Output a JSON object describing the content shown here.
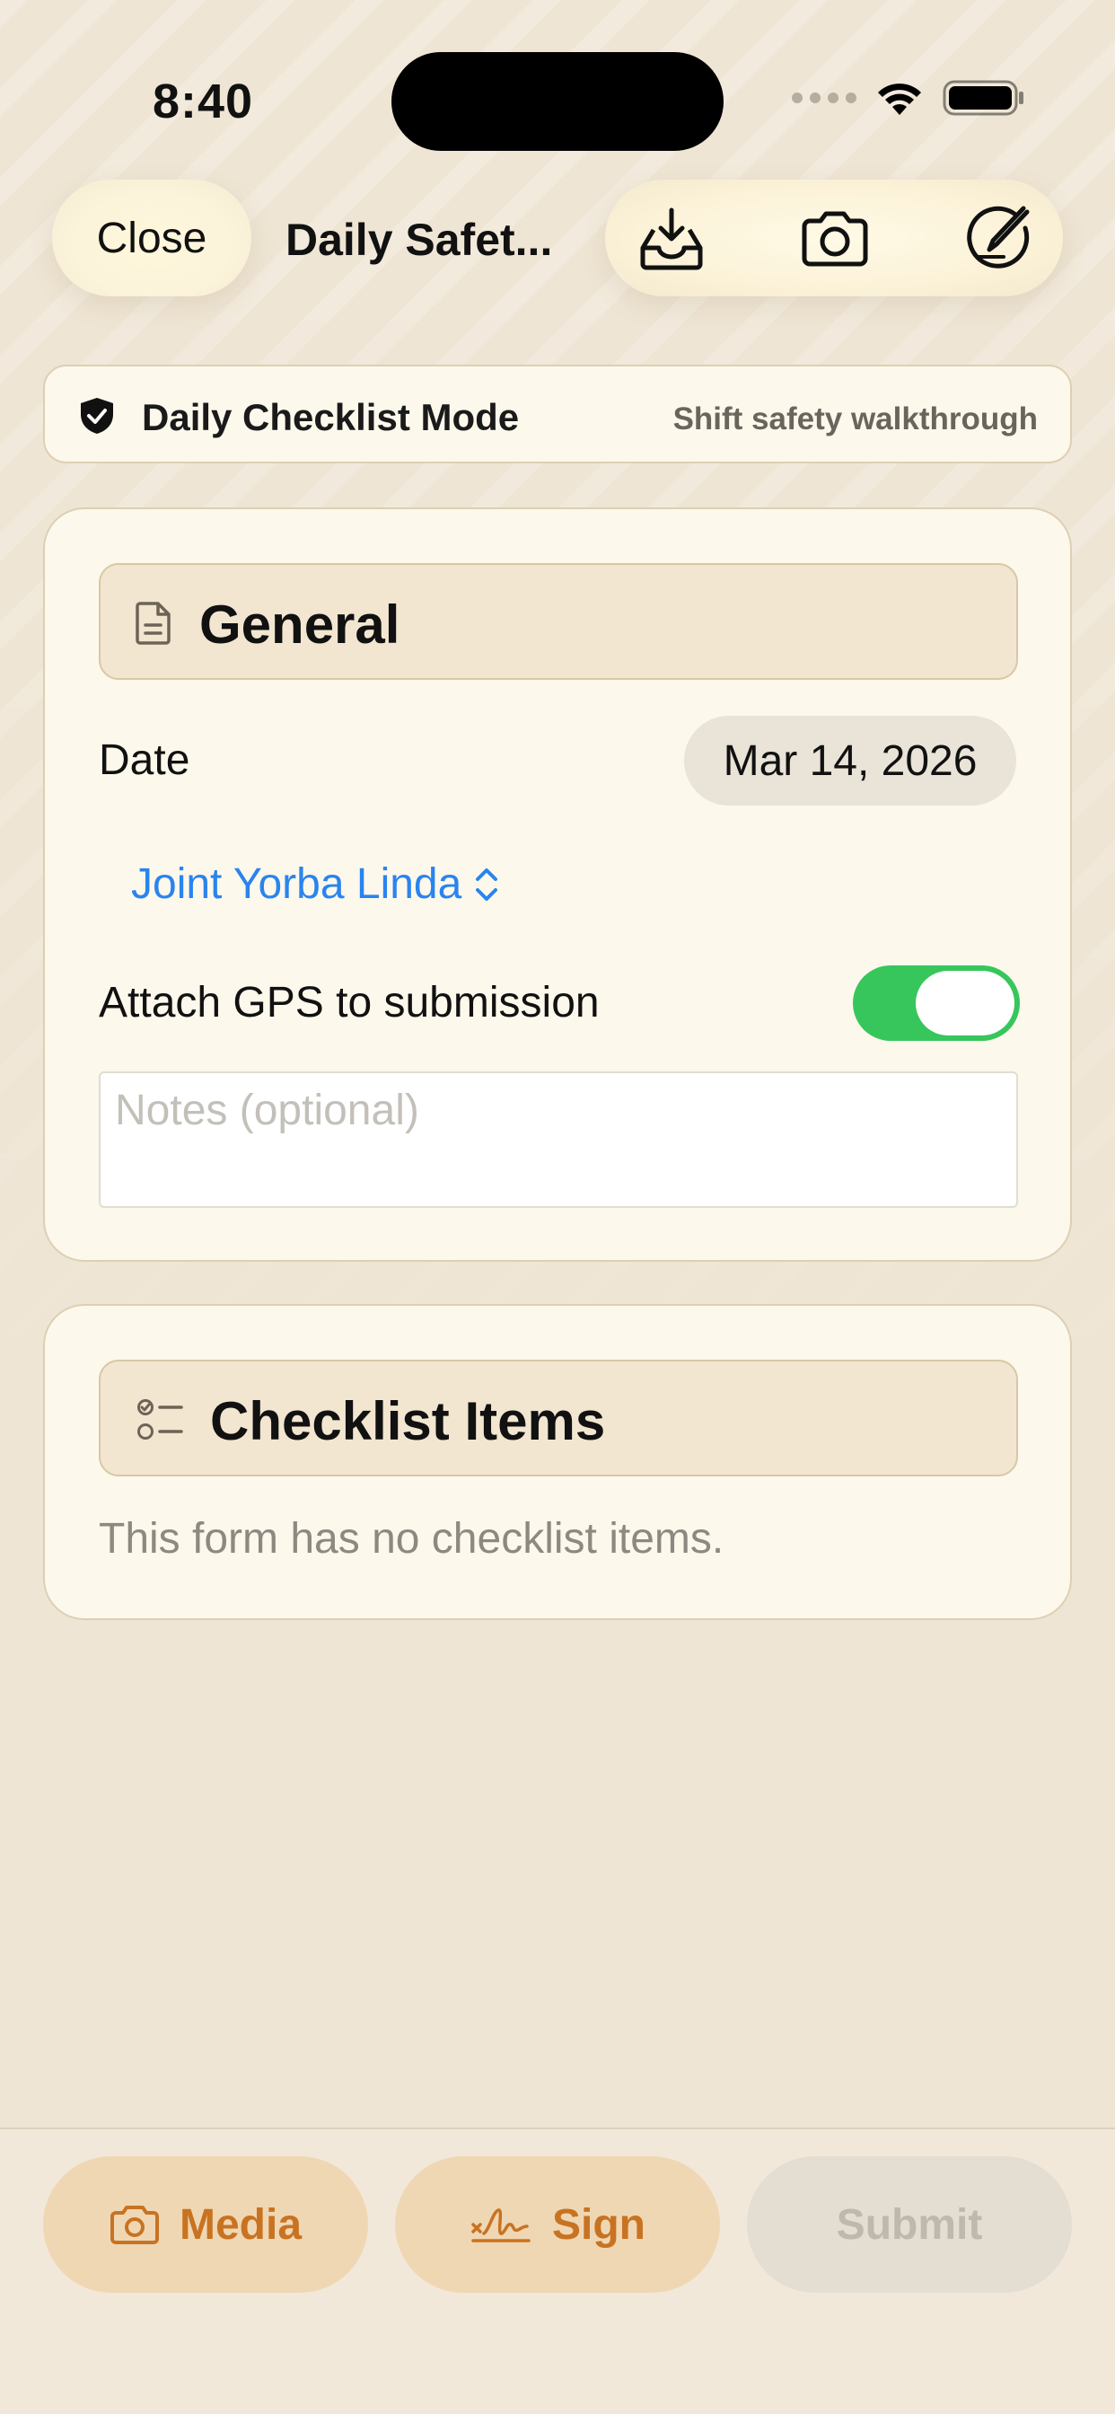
{
  "status_bar": {
    "time": "8:40",
    "icons": [
      "cellular-signal-icon",
      "wifi-icon",
      "battery-icon"
    ]
  },
  "nav": {
    "close_label": "Close",
    "title": "Daily Safet...",
    "actions": [
      "inbox-download-icon",
      "camera-icon",
      "edit-signature-icon"
    ]
  },
  "mode_banner": {
    "icon": "shield-check-icon",
    "title": "Daily Checklist Mode",
    "subtitle": "Shift safety walkthrough"
  },
  "general": {
    "icon": "document-icon",
    "title": "General",
    "date_label": "Date",
    "date_value": "Mar 14, 2026",
    "location_value": "Joint Yorba Linda",
    "gps_label": "Attach GPS to submission",
    "gps_enabled": true,
    "notes_placeholder": "Notes (optional)",
    "notes_value": ""
  },
  "checklist": {
    "icon": "checklist-icon",
    "title": "Checklist Items",
    "empty_message": "This form has no checklist items."
  },
  "bottom_bar": {
    "media_label": "Media",
    "sign_label": "Sign",
    "submit_label": "Submit",
    "submit_enabled": false
  },
  "colors": {
    "background": "#efe5d4",
    "card": "#fdf8ec",
    "accent_orange": "#c87322",
    "link_blue": "#2a84ee",
    "toggle_green": "#37c65c"
  }
}
